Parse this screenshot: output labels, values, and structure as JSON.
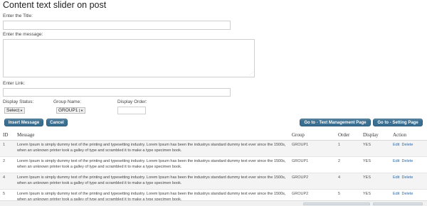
{
  "page_title": "Content text slider on post",
  "form": {
    "title_label": "Enter the Title:",
    "title_value": "",
    "message_label": "Enter the message:",
    "message_value": "",
    "link_label": "Enter Link:",
    "link_value": "",
    "display_status_label": "Display Status:",
    "display_status_value": "Select",
    "group_name_label": "Group Name:",
    "group_name_value": "GROUP1",
    "display_order_label": "Display Order:",
    "display_order_value": ""
  },
  "buttons": {
    "insert": "Insert Message",
    "cancel": "Cancel",
    "text_management": "Go to - Text Management Page",
    "setting": "Go to - Setting Page"
  },
  "table": {
    "headers": {
      "id": "ID",
      "message": "Message",
      "group": "Group",
      "order": "Order",
      "display": "Display",
      "action": "Action"
    },
    "rows": [
      {
        "id": "1",
        "message": "Lorem Ipsum is simply dummy text of the printing and typesetting industry. Lorem Ipsum has been the industrys standard dummy text ever since the 1500s, when an unknown printer took a galley of type and scrambled it to make a type specimen book.",
        "group": "GROUP1",
        "order": "1",
        "display": "YES",
        "edit": "Edit",
        "delete": "Delete"
      },
      {
        "id": "2",
        "message": "Lorem Ipsum is simply dummy text of the printing and typesetting industry. Lorem Ipsum has been the industrys standard dummy text ever since the 1500s, when an unknown printer took a galley of type and scrambled it to make a type specimen book.",
        "group": "GROUP1",
        "order": "2",
        "display": "YES",
        "edit": "Edit",
        "delete": "Delete"
      },
      {
        "id": "4",
        "message": "Lorem Ipsum is simply dummy text of the printing and typesetting industry. Lorem Ipsum has been the industrys standard dummy text ever since the 1500s, when an unknown printer took a galley of type and scrambled it to make a type specimen book.",
        "group": "GROUP2",
        "order": "4",
        "display": "YES",
        "edit": "Edit",
        "delete": "Delete"
      },
      {
        "id": "5",
        "message": "Lorem Ipsum is simply dummy text of the printing and typesetting industry. Lorem Ipsum has been the industrys standard dummy text ever since the 1500s, when an unknown printer took a galley of type and scrambled it to make a type specimen book.",
        "group": "GROUP2",
        "order": "5",
        "display": "YES",
        "edit": "Edit",
        "delete": "Delete"
      }
    ]
  },
  "colors": {
    "button_bg": "#3b6f91",
    "link": "#2a6aa8",
    "row_alt": "#f4f4f4"
  }
}
